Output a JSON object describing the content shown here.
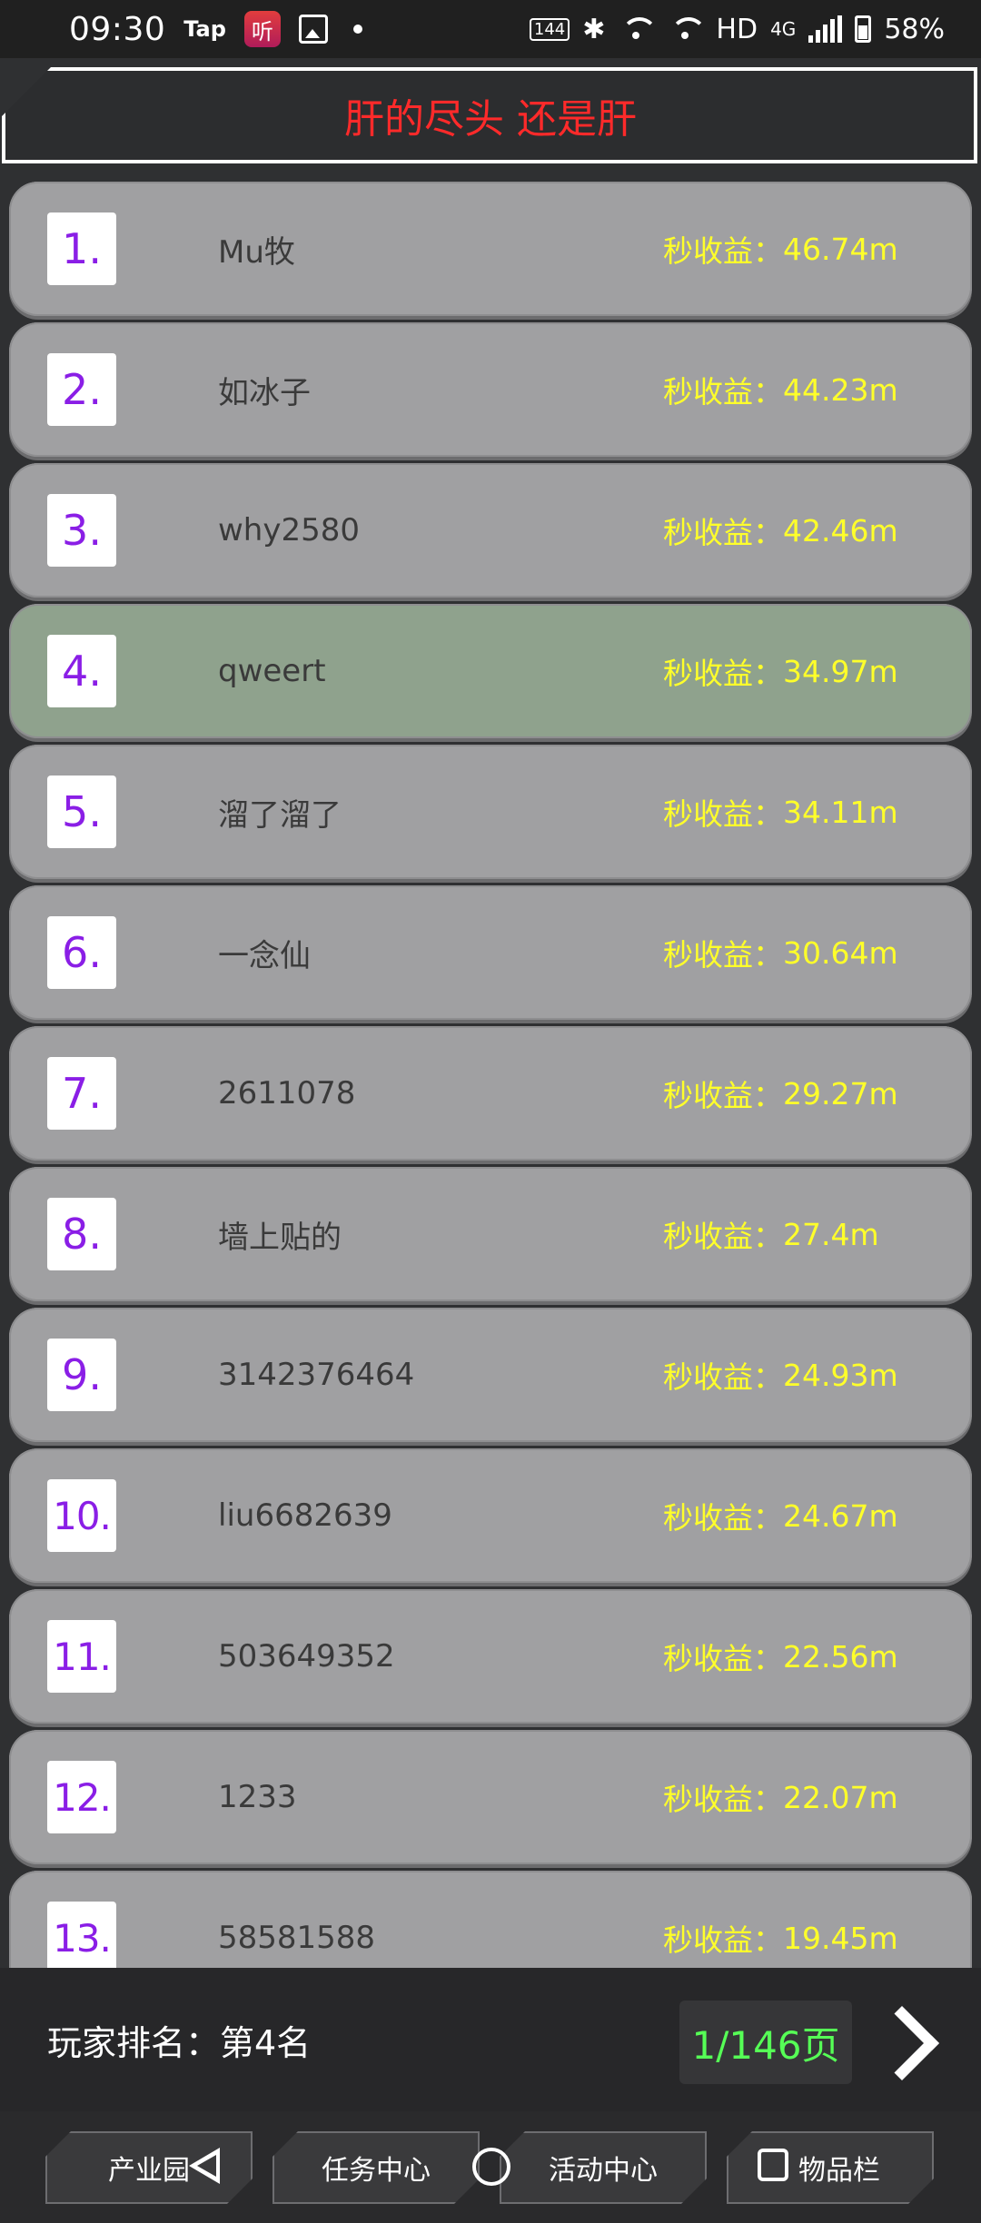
{
  "status_bar": {
    "time": "09:30",
    "tap_label": "Tap",
    "app_icon_text": "听",
    "refresh_rate": "144",
    "hd_label": "HD",
    "network_label": "4G",
    "battery_percent": "58%"
  },
  "header": {
    "title": "肝的尽头 还是肝"
  },
  "leaderboard": {
    "income_prefix": "秒收益：",
    "highlight_color": "#8fa28d",
    "rows": [
      {
        "rank": "1.",
        "name": "Mu牧",
        "income": "46.74m"
      },
      {
        "rank": "2.",
        "name": "如冰子",
        "income": "44.23m"
      },
      {
        "rank": "3.",
        "name": "why2580",
        "income": "42.46m"
      },
      {
        "rank": "4.",
        "name": "qweert",
        "income": "34.97m"
      },
      {
        "rank": "5.",
        "name": "溜了溜了",
        "income": "34.11m"
      },
      {
        "rank": "6.",
        "name": "一念仙",
        "income": "30.64m"
      },
      {
        "rank": "7.",
        "name": "2611078",
        "income": "29.27m"
      },
      {
        "rank": "8.",
        "name": "墙上贴的",
        "income": "27.4m"
      },
      {
        "rank": "9.",
        "name": "3142376464",
        "income": "24.93m"
      },
      {
        "rank": "10.",
        "name": "liu6682639",
        "income": "24.67m"
      },
      {
        "rank": "11.",
        "name": "503649352",
        "income": "22.56m"
      },
      {
        "rank": "12.",
        "name": "1233",
        "income": "22.07m"
      },
      {
        "rank": "13.",
        "name": "58581588",
        "income": "19.45m"
      }
    ]
  },
  "footer": {
    "my_rank": "玩家排名：第4名",
    "page_indicator": "1/146页"
  },
  "bottom_nav": {
    "items": [
      "产业园",
      "任务中心",
      "活动中心",
      "物品栏"
    ]
  }
}
